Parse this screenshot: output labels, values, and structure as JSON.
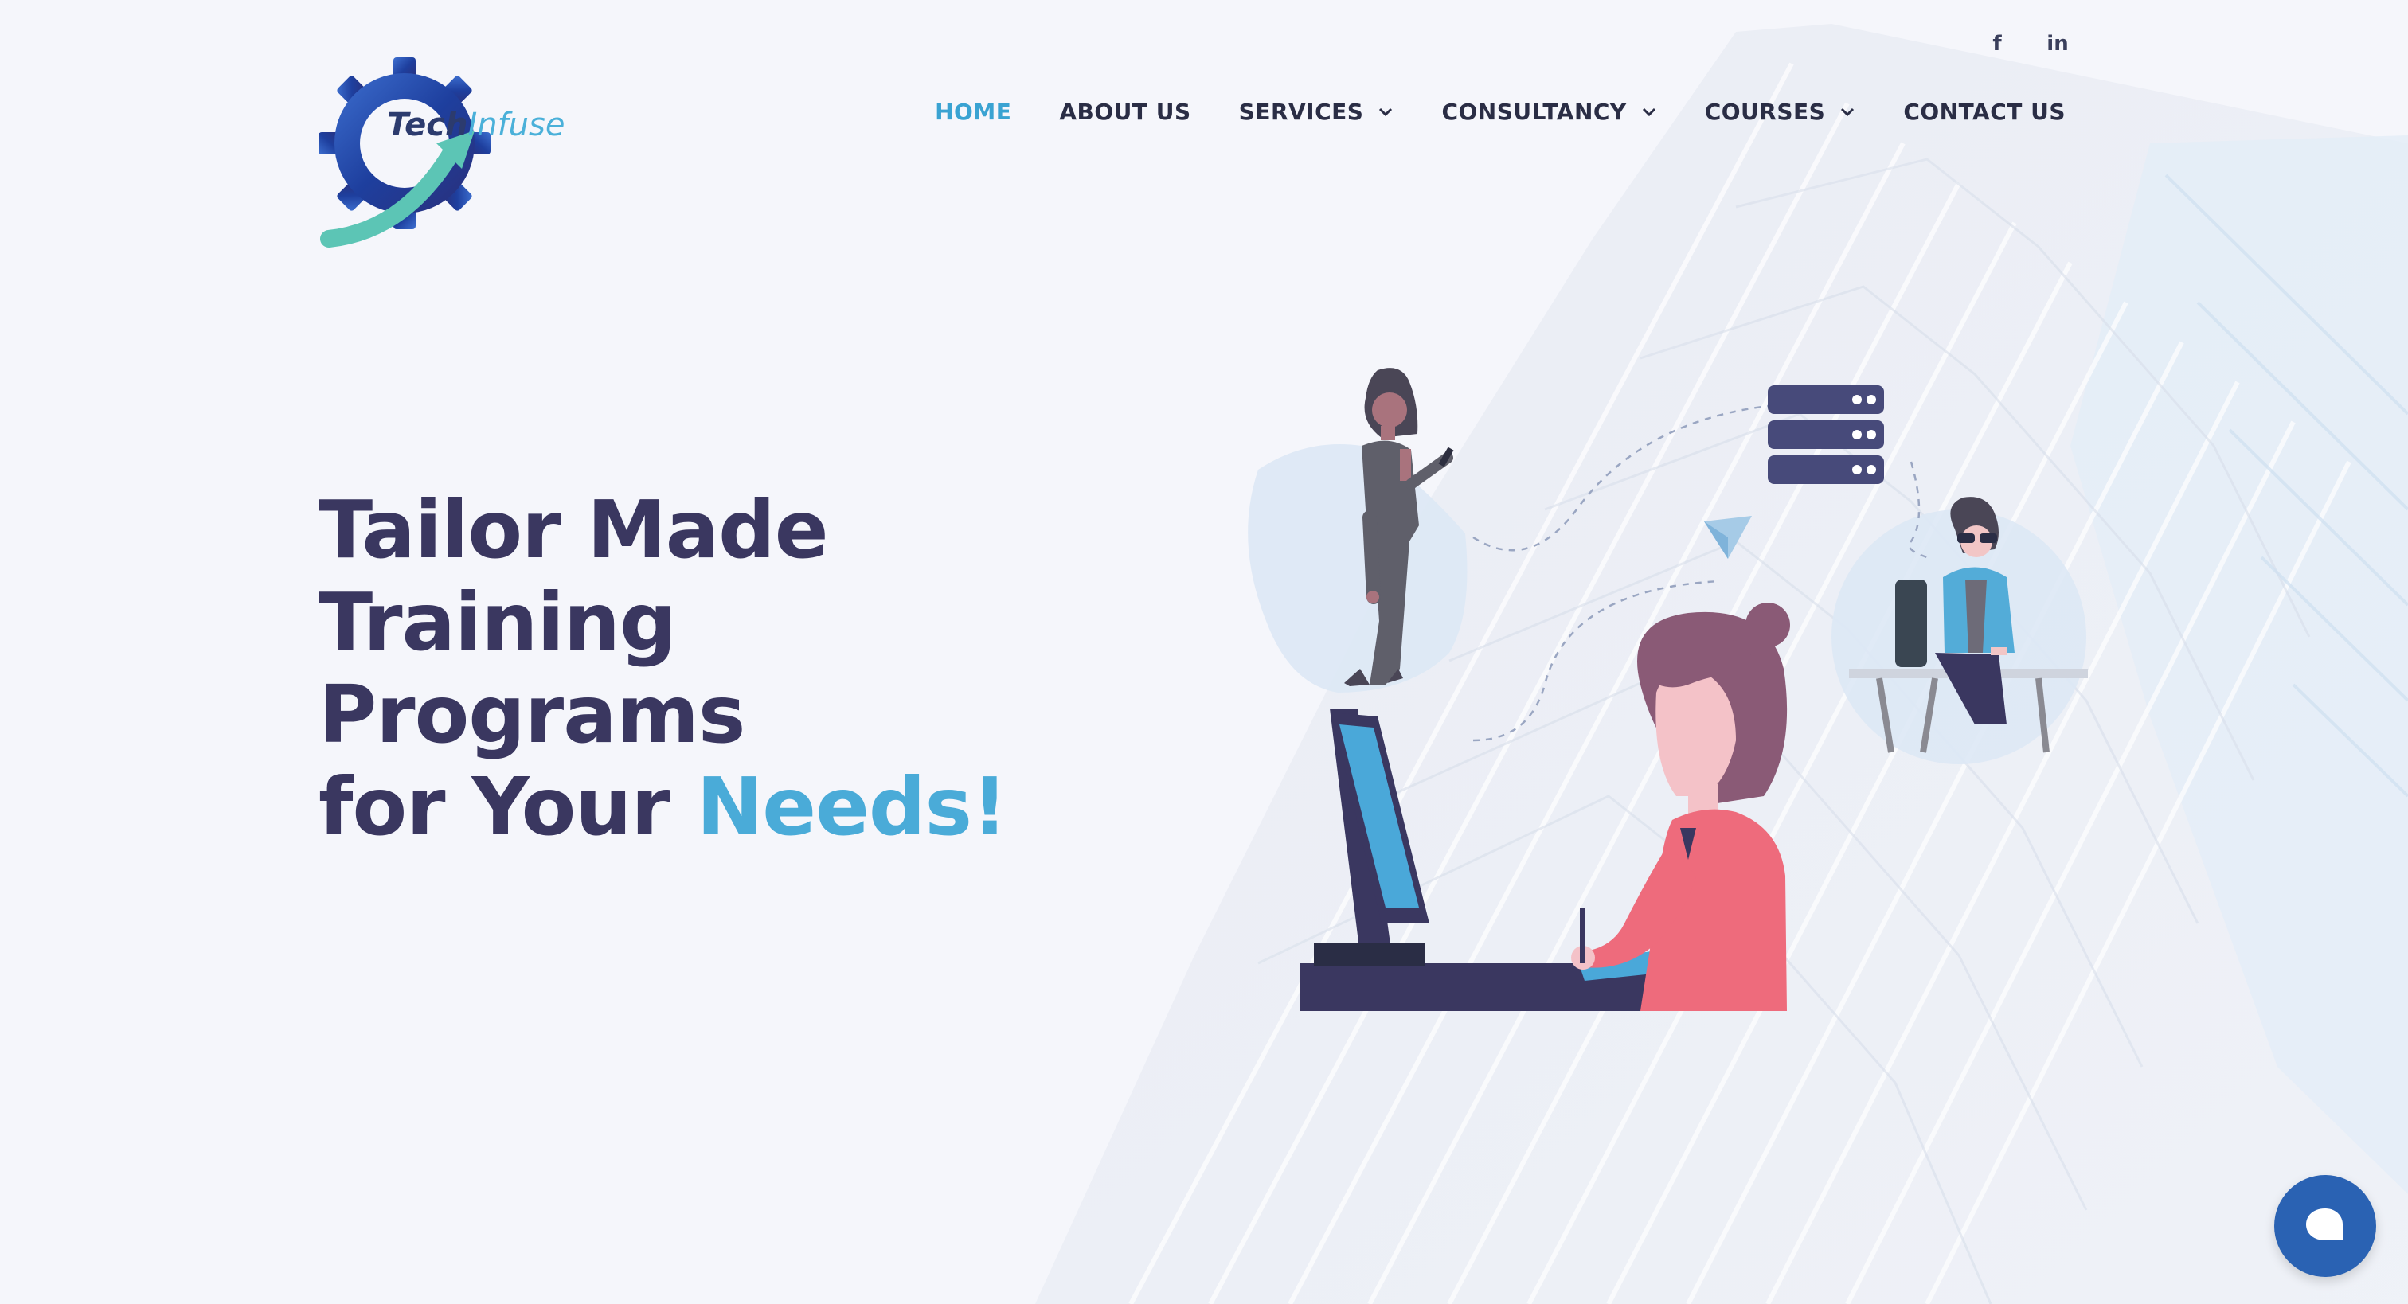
{
  "brand": {
    "name_part1": "Tech",
    "name_part2": "Infuse",
    "primary_color": "#2c3b6e",
    "accent_color": "#4ab0d9"
  },
  "social": [
    {
      "icon": "facebook-icon",
      "glyph": "f"
    },
    {
      "icon": "linkedin-icon",
      "glyph": "in"
    }
  ],
  "nav": {
    "items": [
      {
        "label": "HOME",
        "active": true,
        "dropdown": false
      },
      {
        "label": "ABOUT US",
        "active": false,
        "dropdown": false
      },
      {
        "label": "SERVICES",
        "active": false,
        "dropdown": true
      },
      {
        "label": "CONSULTANCY",
        "active": false,
        "dropdown": true
      },
      {
        "label": "COURSES",
        "active": false,
        "dropdown": true
      },
      {
        "label": "CONTACT US",
        "active": false,
        "dropdown": false
      }
    ]
  },
  "hero": {
    "line1": "Tailor Made Training",
    "line2": "Programs",
    "line3_prefix": "for Your ",
    "line3_accent": "Needs!"
  },
  "chat": {
    "icon": "chat-bubble-icon",
    "color": "#2a62b3"
  }
}
